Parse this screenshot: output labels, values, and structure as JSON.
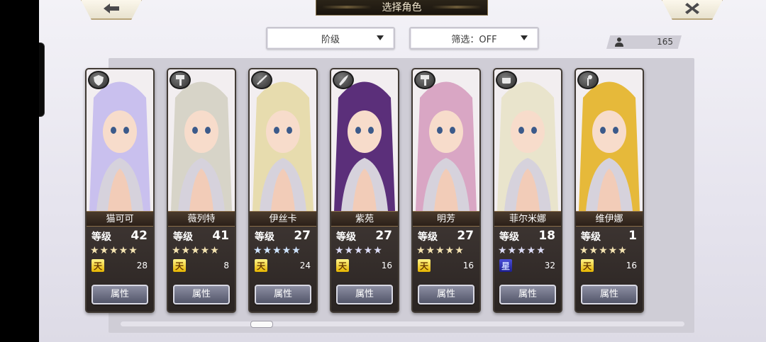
{
  "header": {
    "title": "选择角色",
    "back_icon": "back-arrow-icon",
    "close_icon": "close-x-icon"
  },
  "toolbar": {
    "sort_label": "阶级",
    "filter_label": "筛选：OFF"
  },
  "roster_count": "165",
  "ui_labels": {
    "level": "等级",
    "attributes": "属性"
  },
  "characters": [
    {
      "name": "猫可可",
      "level": "42",
      "stars": "★★★★★",
      "star_color": "gold",
      "grade": "天",
      "count": "28",
      "class_icon": "shield-class-icon",
      "hair": "#c9c0ee"
    },
    {
      "name": "薇列特",
      "level": "41",
      "stars": "★★★★★",
      "star_color": "gold",
      "grade": "天",
      "count": "8",
      "class_icon": "hammer-class-icon",
      "hair": "#d7d4c8"
    },
    {
      "name": "伊丝卡",
      "level": "27",
      "stars": "★★★★★",
      "star_color": "blue",
      "grade": "天",
      "count": "24",
      "class_icon": "sword-class-icon",
      "hair": "#e7dcae"
    },
    {
      "name": "紫苑",
      "level": "27",
      "stars": "★★★★★",
      "star_color": "silver",
      "grade": "天",
      "count": "16",
      "class_icon": "blade-class-icon",
      "hair": "#5b2f7a"
    },
    {
      "name": "明芳",
      "level": "27",
      "stars": "★★★★★",
      "star_color": "gold",
      "grade": "天",
      "count": "16",
      "class_icon": "hammer-class-icon",
      "hair": "#d9a6c4"
    },
    {
      "name": "菲尔米娜",
      "level": "18",
      "stars": "★★★★★",
      "star_color": "silver",
      "grade": "星",
      "count": "32",
      "class_icon": "fist-class-icon",
      "hair": "#e9e4cc"
    },
    {
      "name": "维伊娜",
      "level": "1",
      "stars": "★★★★★",
      "star_color": "gold",
      "grade": "天",
      "count": "16",
      "class_icon": "staff-class-icon",
      "hair": "#e6b93a"
    }
  ],
  "colors": {
    "background": "#e6e4ee",
    "card_frame": "#423b35",
    "title_bar": "#1a150e"
  }
}
